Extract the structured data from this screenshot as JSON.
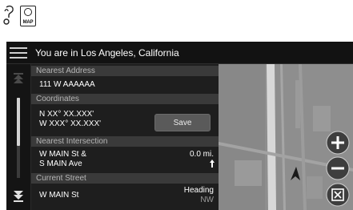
{
  "doc_icons": {
    "map_label": "MAP"
  },
  "header": {
    "title": "You are in Los Angeles, California"
  },
  "sections": {
    "nearest_address": {
      "label": "Nearest Address",
      "value": "111 W AAAAAA"
    },
    "coordinates": {
      "label": "Coordinates",
      "line1": "N XX° XX.XXX'",
      "line2": "W XXX° XX.XXX'",
      "save_label": "Save"
    },
    "nearest_intersection": {
      "label": "Nearest Intersection",
      "line1": "W MAIN St &",
      "line2": "S MAIN Ave",
      "distance": "0.0 mi."
    },
    "current_street": {
      "label": "Current Street",
      "value": "W MAIN St",
      "heading_label": "Heading",
      "heading_value": "NW"
    }
  },
  "colors": {
    "header_bar": "#3a3a3a",
    "panel": "#1e1e1e",
    "map": "#8a8a8a",
    "button": "#5a5a5a"
  }
}
